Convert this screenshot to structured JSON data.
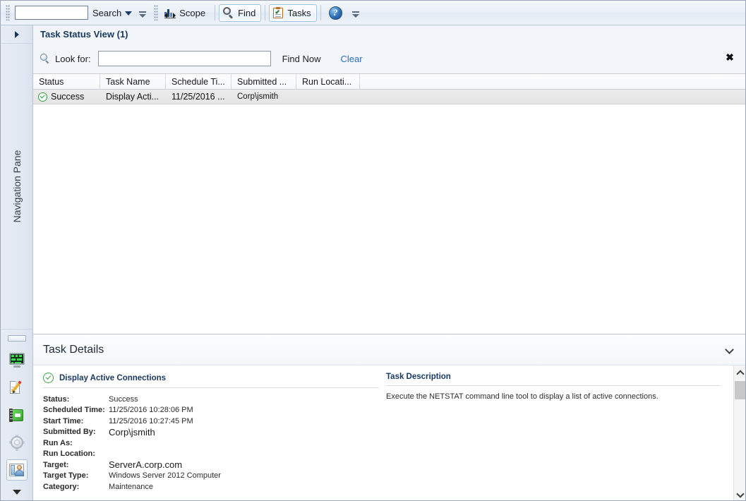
{
  "toolbar": {
    "search_value": "",
    "search_label": "Search",
    "scope_label": "Scope",
    "find_label": "Find",
    "tasks_label": "Tasks",
    "help_glyph": "?",
    "icons": {
      "search_dropdown": "caret-down-icon",
      "scope": "scope-icon",
      "find": "magnifier-icon",
      "tasks": "clipboard-check-icon",
      "help": "help-circle-icon",
      "overflow": "toolbar-overflow-icon"
    }
  },
  "navpane": {
    "title": "Navigation Pane",
    "expand_icon": "chevron-right-icon",
    "items": [
      {
        "name": "monitoring",
        "icon": "monitoring-icon",
        "selected": false
      },
      {
        "name": "authoring",
        "icon": "authoring-pencil-icon",
        "selected": false
      },
      {
        "name": "reporting",
        "icon": "reporting-book-icon",
        "selected": false
      },
      {
        "name": "administration",
        "icon": "gear-icon",
        "selected": false
      },
      {
        "name": "my-workspace",
        "icon": "workspace-person-icon",
        "selected": true
      }
    ],
    "bottom_icon": "configure-buttons-icon"
  },
  "view": {
    "title": "Task Status View (1)"
  },
  "findbar": {
    "search_icon": "magnifier-icon",
    "look_for_label": "Look for:",
    "look_for_value": "",
    "look_for_placeholder": "",
    "find_now_label": "Find Now",
    "clear_label": "Clear",
    "close_glyph": "✖"
  },
  "grid": {
    "columns": [
      {
        "key": "status",
        "label": "Status"
      },
      {
        "key": "task_name",
        "label": "Task Name"
      },
      {
        "key": "schedule_time",
        "label": "Schedule Ti..."
      },
      {
        "key": "submitted_by",
        "label": "Submitted ..."
      },
      {
        "key": "run_location",
        "label": "Run Locati..."
      },
      {
        "key": "rest",
        "label": ""
      }
    ],
    "rows": [
      {
        "status": "Success",
        "status_icon": "success-check-icon",
        "task_name": "Display Acti...",
        "schedule_time": "11/25/2016 ...",
        "submitted_by": "Corp\\jsmith",
        "run_location": "",
        "selected": true
      }
    ]
  },
  "details": {
    "title": "Task Details",
    "collapse_icon": "chevron-down-icon",
    "task": {
      "status_icon": "success-check-icon",
      "name": "Display Active Connections",
      "fields": [
        {
          "label": "Status:",
          "value": "Success",
          "overlay": false
        },
        {
          "label": "Scheduled Time:",
          "value": "11/25/2016 10:28:06 PM",
          "overlay": false
        },
        {
          "label": "Start Time:",
          "value": "11/25/2016 10:27:45 PM",
          "overlay": false
        },
        {
          "label": "Submitted By:",
          "value": "Corp\\jsmith",
          "overlay": true
        },
        {
          "label": "Run As:",
          "value": "",
          "overlay": false
        },
        {
          "label": "Run Location:",
          "value": "",
          "overlay": false
        },
        {
          "label": "Target:",
          "value": "ServerA.corp.com",
          "overlay": true
        },
        {
          "label": "Target Type:",
          "value": "Windows Server 2012 Computer",
          "overlay": false
        },
        {
          "label": "Category:",
          "value": "Maintenance",
          "overlay": false
        }
      ]
    },
    "description": {
      "title": "Task Description",
      "text": "Execute the NETSTAT command line tool to display a list of active connections."
    },
    "scrollbar": {
      "up_icon": "scroll-up-icon",
      "down_icon": "scroll-down-icon"
    }
  },
  "colors": {
    "accent_blue": "#17375e",
    "link_blue": "#2a6ebb",
    "success_green": "#2f9e41",
    "chrome": "#e7ecf4"
  }
}
